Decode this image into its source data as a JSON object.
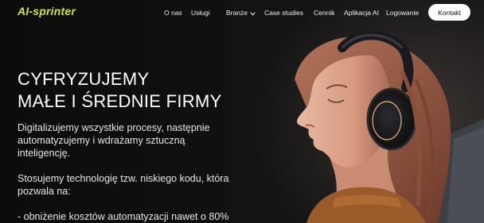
{
  "brand": {
    "logo": "AI-sprinter",
    "accent": "#c6e83b"
  },
  "nav": {
    "items": [
      {
        "label": "O nas"
      },
      {
        "label": "Usługi"
      },
      {
        "label": "Branże",
        "has_dropdown": true
      },
      {
        "label": "Case studies"
      },
      {
        "label": "Cennik"
      },
      {
        "label": "Aplikacja AI"
      },
      {
        "label": "Logowanie"
      }
    ],
    "cta": "Kontakt"
  },
  "hero": {
    "headline_line1": "CYFRYZUJEMY",
    "headline_line2": "MAŁE I ŚREDNIE FIRMY",
    "paragraph1_line1": "Digitalizujemy wszystkie procesy, następnie",
    "paragraph1_line2": "automatyzujemy i wdrażamy sztuczną",
    "paragraph1_line3": "inteligencję.",
    "paragraph2_line1": "Stosujemy technologię tzw. niskiego kodu, która",
    "paragraph2_line2": "pozwala na:",
    "bullet1": "- obniżenie kosztów automatyzacji nawet o 80%"
  },
  "icons": {
    "dropdown": "chevron-down-icon"
  }
}
